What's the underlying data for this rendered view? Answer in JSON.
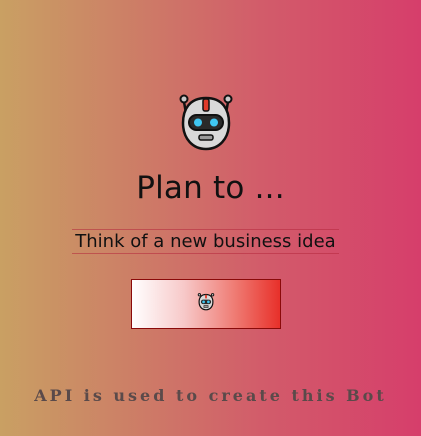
{
  "hero": {
    "icon": "robot-icon",
    "title": "Plan to ..."
  },
  "prompt": {
    "text": "Think of a new business idea"
  },
  "generate_button": {
    "icon": "robot-icon"
  },
  "footer": {
    "text": "API is used to create this Bot"
  },
  "colors": {
    "gradient_start": "#c9a063",
    "gradient_end": "#d63e6b",
    "button_accent": "#e8302a"
  }
}
